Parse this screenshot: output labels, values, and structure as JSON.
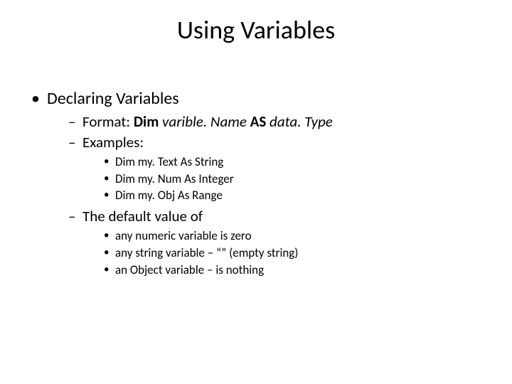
{
  "title": "Using Variables",
  "l1_item": "Declaring Variables",
  "format": {
    "label": "Format: ",
    "dim": "Dim",
    "space1": " ",
    "var": "varible. Name",
    "space2": " ",
    "as": "AS",
    "space3": " ",
    "type": "data. Type"
  },
  "examples_label": "Examples:",
  "examples": [
    "Dim my. Text As String",
    "Dim my. Num As Integer",
    "Dim my. Obj As Range"
  ],
  "default_label": "The default value of",
  "defaults": [
    "any numeric variable is zero",
    "any string variable – “” (empty string)",
    "an Object variable – is nothing"
  ]
}
